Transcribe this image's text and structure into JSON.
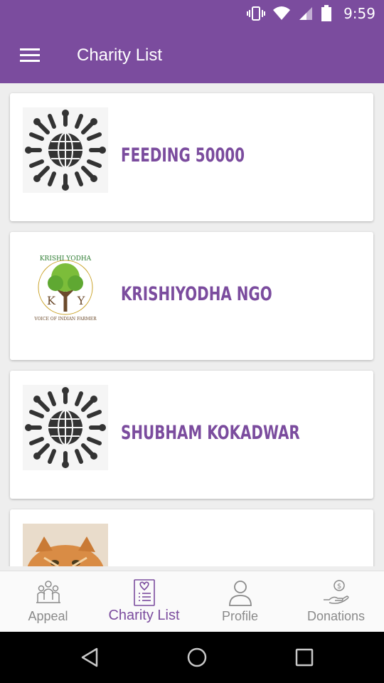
{
  "status": {
    "time": "9:59"
  },
  "appbar": {
    "title": "Charity List"
  },
  "charities": [
    {
      "name": "FEEDING 50000",
      "logo": "globe-people-logo"
    },
    {
      "name": "KRISHIYODHA NGO",
      "logo": "krishi-yodha-tree-logo",
      "logo_text_top": "KRISHI YODHA",
      "logo_text_bottom": "VOICE OF INDIAN FARMER"
    },
    {
      "name": "SHUBHAM KOKADWAR",
      "logo": "globe-people-logo"
    },
    {
      "name": "",
      "logo": "cat-photo"
    }
  ],
  "nav": {
    "appeal": "Appeal",
    "charity_list": "Charity List",
    "profile": "Profile",
    "donations": "Donations"
  },
  "colors": {
    "primary": "#7b4c9e",
    "inactive": "#8a8a8a"
  }
}
